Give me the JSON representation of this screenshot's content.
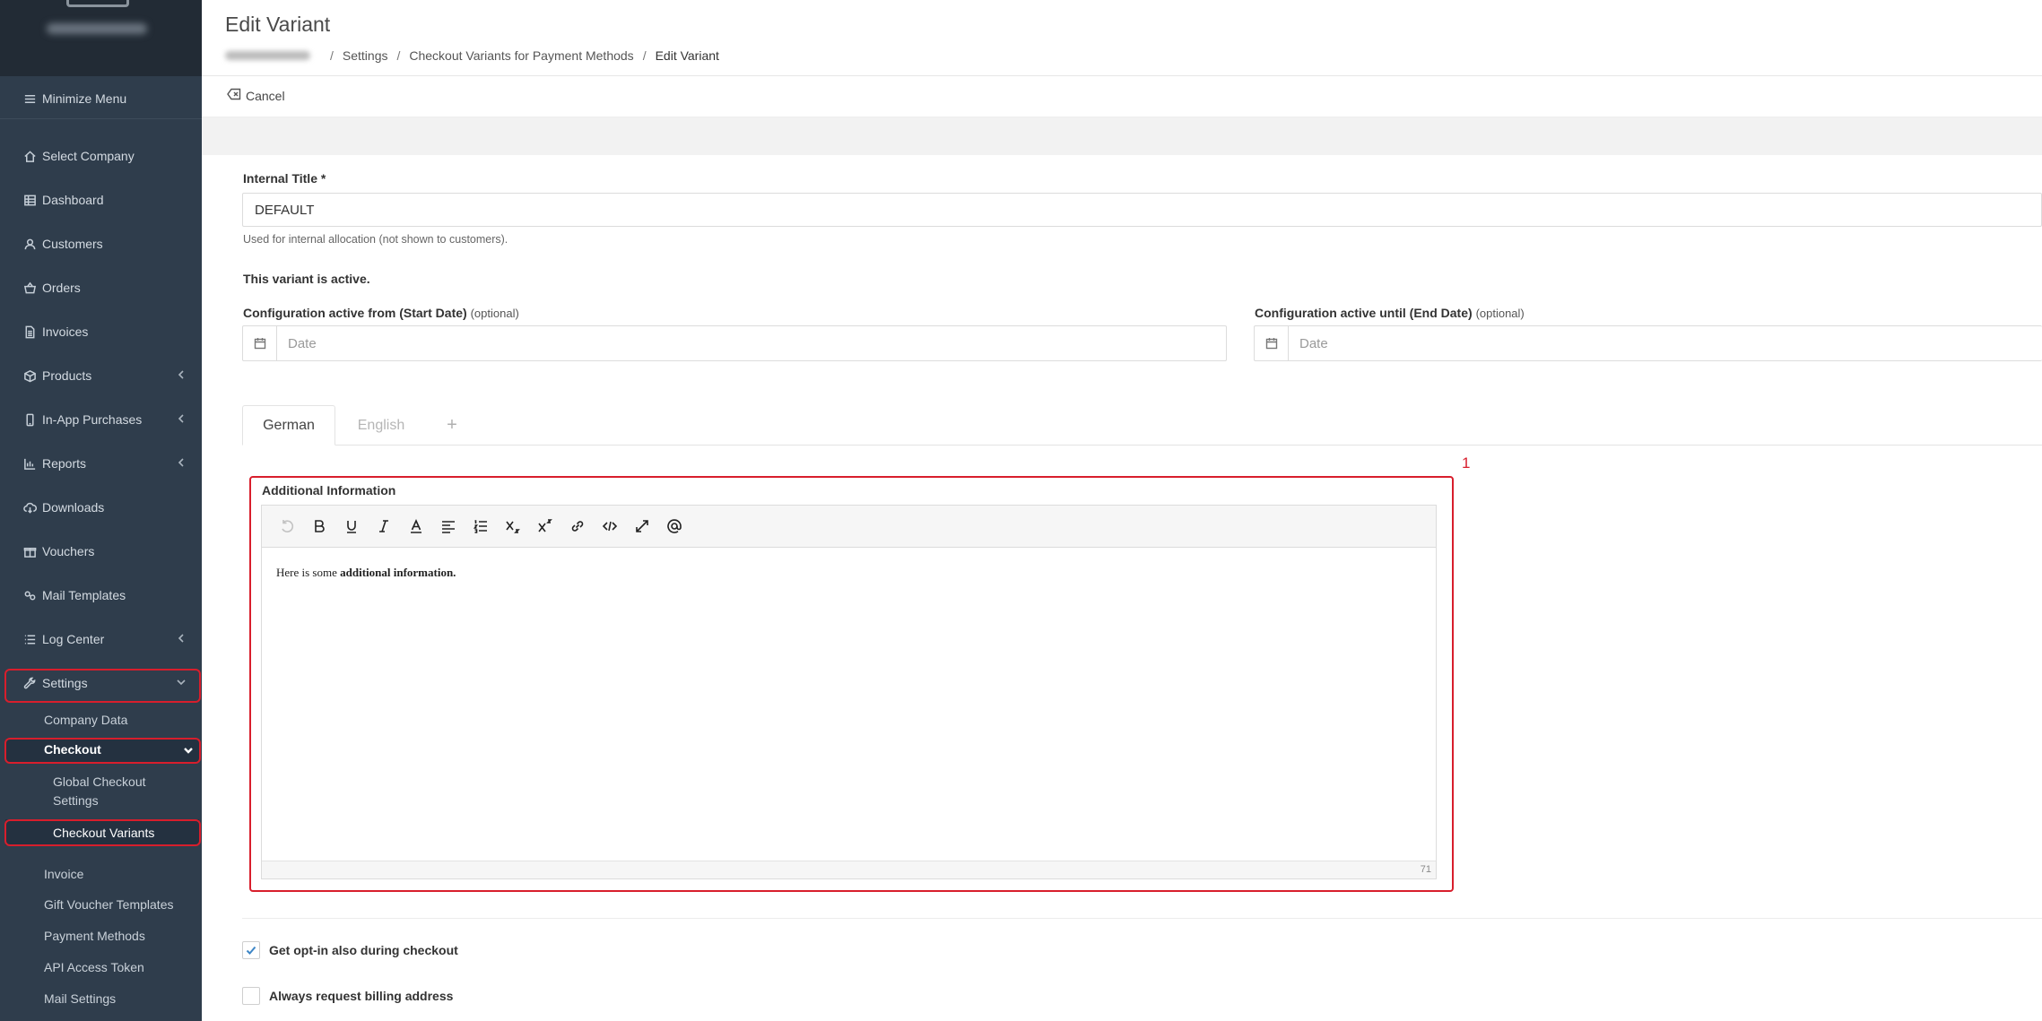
{
  "sidebar": {
    "minimize_label": "Minimize Menu",
    "items": [
      {
        "label": "Select Company",
        "icon": "home-icon"
      },
      {
        "label": "Dashboard",
        "icon": "table-icon"
      },
      {
        "label": "Customers",
        "icon": "user-icon"
      },
      {
        "label": "Orders",
        "icon": "basket-icon"
      },
      {
        "label": "Invoices",
        "icon": "document-icon"
      },
      {
        "label": "Products",
        "icon": "box-icon"
      },
      {
        "label": "In-App Purchases",
        "icon": "mobile-icon"
      },
      {
        "label": "Reports",
        "icon": "chart-icon"
      },
      {
        "label": "Downloads",
        "icon": "cloud-download-icon"
      },
      {
        "label": "Vouchers",
        "icon": "gift-icon"
      },
      {
        "label": "Mail Templates",
        "icon": "mail-template-icon"
      },
      {
        "label": "Log Center",
        "icon": "list-icon"
      },
      {
        "label": "Settings",
        "icon": "wrench-icon"
      }
    ],
    "settings_children": {
      "company_data": "Company Data",
      "checkout": "Checkout",
      "global_checkout_settings_line1": "Global Checkout",
      "global_checkout_settings_line2": "Settings",
      "checkout_variants": "Checkout Variants",
      "invoice": "Invoice",
      "gift_voucher_templates": "Gift Voucher Templates",
      "payment_methods": "Payment Methods",
      "api_access_token": "API Access Token",
      "mail_settings": "Mail Settings"
    }
  },
  "header": {
    "title": "Edit Variant",
    "breadcrumb": [
      "Settings",
      "Checkout Variants for Payment Methods",
      "Edit Variant"
    ]
  },
  "toolbar": {
    "cancel_label": "Cancel"
  },
  "form": {
    "internal_title_label": "Internal Title *",
    "internal_title_value": "DEFAULT",
    "internal_title_help": "Used for internal allocation (not shown to customers).",
    "active_status": "This variant is active.",
    "start_date_label": "Configuration active from (Start Date)",
    "start_date_optional": "(optional)",
    "start_date_placeholder": "Date",
    "end_date_label": "Configuration active until (End Date)",
    "end_date_optional": "(optional)",
    "end_date_placeholder": "Date",
    "tabs": [
      "German",
      "English",
      "+"
    ],
    "annotation_number": "1",
    "editor_label": "Additional Information",
    "editor_text_plain": "Here is some ",
    "editor_text_bold": "additional information.",
    "editor_char_count": "71",
    "opt_in_label": "Get opt-in also during checkout",
    "billing_label": "Always request billing address"
  },
  "colors": {
    "sidebar_bg": "#2f3d4c",
    "highlight_red": "#d81e2c",
    "checkbox_check": "#3d86c6"
  }
}
